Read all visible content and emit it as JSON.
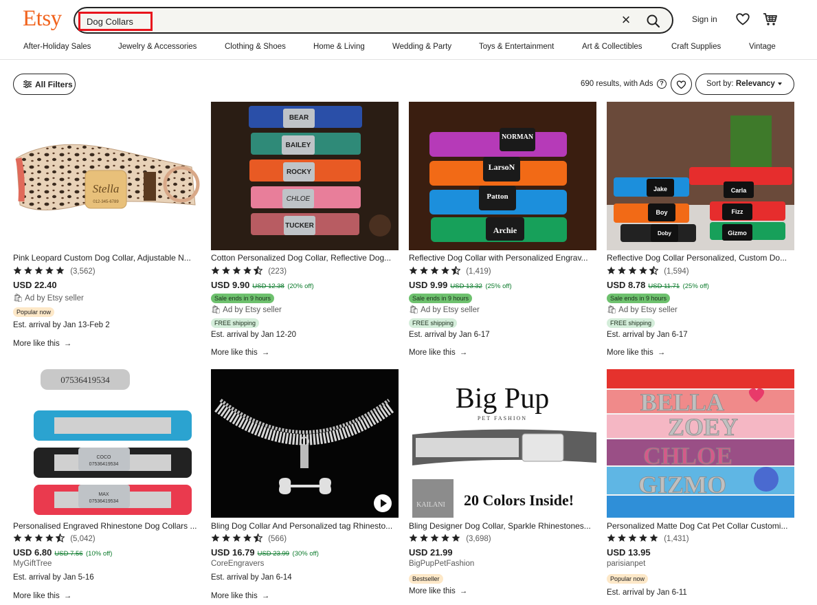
{
  "header": {
    "logo": "Etsy",
    "search_value": "Dog Collars",
    "clear_symbol": "×",
    "signin": "Sign in"
  },
  "nav": [
    "After-Holiday Sales",
    "Jewelry & Accessories",
    "Clothing & Shoes",
    "Home & Living",
    "Wedding & Party",
    "Toys & Entertainment",
    "Art & Collectibles",
    "Craft Supplies",
    "Vintage"
  ],
  "toolbar": {
    "filters_label": "All Filters",
    "results_text": "690 results, with Ads",
    "help_symbol": "?",
    "sort_prefix": "Sort by: ",
    "sort_value": "Relevancy"
  },
  "more_like_this": "More like this",
  "arrow": "→",
  "listings": [
    {
      "title": "Pink Leopard Custom Dog Collar, Adjustable N...",
      "rating": 5,
      "reviews": "(3,562)",
      "price": "USD 22.40",
      "original_price": "",
      "discount": "",
      "sale_badge": "",
      "seller": "Ad by Etsy seller",
      "shipping_badge": "",
      "popular_badge": "Popular now",
      "arrival": "Est. arrival by Jan 13-Feb 2",
      "image": "pink-leopard-collar"
    },
    {
      "title": "Cotton Personalized Dog Collar, Reflective Dog...",
      "rating": 4.5,
      "reviews": "(223)",
      "price": "USD 9.90",
      "original_price": "USD 12.38",
      "discount": "(20% off)",
      "sale_badge": "Sale ends in 9 hours",
      "seller": "Ad by Etsy seller",
      "shipping_badge": "FREE shipping",
      "popular_badge": "",
      "arrival": "Est. arrival by Jan 12-20",
      "image": "stacked-cotton-collars"
    },
    {
      "title": "Reflective Dog Collar with Personalized Engrav...",
      "rating": 4.5,
      "reviews": "(1,419)",
      "price": "USD 9.99",
      "original_price": "USD 13.32",
      "discount": "(25% off)",
      "sale_badge": "Sale ends in 9 hours",
      "seller": "Ad by Etsy seller",
      "shipping_badge": "FREE shipping",
      "popular_badge": "",
      "arrival": "Est. arrival by Jan 6-17",
      "image": "reflective-collars-stack"
    },
    {
      "title": "Reflective Dog Collar Personalized, Custom Do...",
      "rating": 4.5,
      "reviews": "(1,594)",
      "price": "USD 8.78",
      "original_price": "USD 11.71",
      "discount": "(25% off)",
      "sale_badge": "Sale ends in 9 hours",
      "seller": "Ad by Etsy seller",
      "shipping_badge": "FREE shipping",
      "popular_badge": "",
      "arrival": "Est. arrival by Jan 6-17",
      "image": "collars-brick-wall"
    },
    {
      "title": "Personalised Engraved Rhinestone Dog Collars ...",
      "rating": 4.5,
      "reviews": "(5,042)",
      "price": "USD 6.80",
      "original_price": "USD 7.56",
      "discount": "(10% off)",
      "sale_badge": "",
      "seller": "MyGiftTree",
      "shipping_badge": "",
      "popular_badge": "",
      "arrival": "Est. arrival by Jan 5-16",
      "image": "rhinestone-engraved-collars"
    },
    {
      "title": "Bling Dog Collar And Personalized tag Rhinesto...",
      "rating": 4.5,
      "reviews": "(566)",
      "price": "USD 16.79",
      "original_price": "USD 23.99",
      "discount": "(30% off)",
      "sale_badge": "",
      "seller": "CoreEngravers",
      "shipping_badge": "",
      "popular_badge": "",
      "arrival": "Est. arrival by Jan 6-14",
      "image": "bling-collar-bone-tag"
    },
    {
      "title": "Bling Designer Dog Collar, Sparkle Rhinestones...",
      "rating": 5,
      "reviews": "(3,698)",
      "price": "USD 21.99",
      "original_price": "",
      "discount": "",
      "sale_badge": "",
      "seller": "BigPupPetFashion",
      "shipping_badge": "",
      "popular_badge": "Bestseller",
      "arrival": "",
      "image": "big-pup-collar",
      "image_text": {
        "brand": "Big Pup",
        "sub": "PET FASHION",
        "tag": "KAILANI",
        "tagline": "20 Colors Inside!"
      }
    },
    {
      "title": "Personalized Matte Dog Cat Pet Collar Customi...",
      "rating": 5,
      "reviews": "(1,431)",
      "price": "USD 13.95",
      "original_price": "",
      "discount": "",
      "sale_badge": "",
      "seller": "parisianpet",
      "shipping_badge": "",
      "popular_badge": "Popular now",
      "arrival": "Est. arrival by Jan 6-11",
      "image": "letter-charm-collars"
    }
  ],
  "colors": {
    "brand": "#f1641e",
    "search_highlight": "#e8141c",
    "sale_badge": "#6ec16e",
    "ship_badge": "#d4edda",
    "popular_badge": "#fde8c8",
    "discount_text": "#0b7a2b"
  }
}
